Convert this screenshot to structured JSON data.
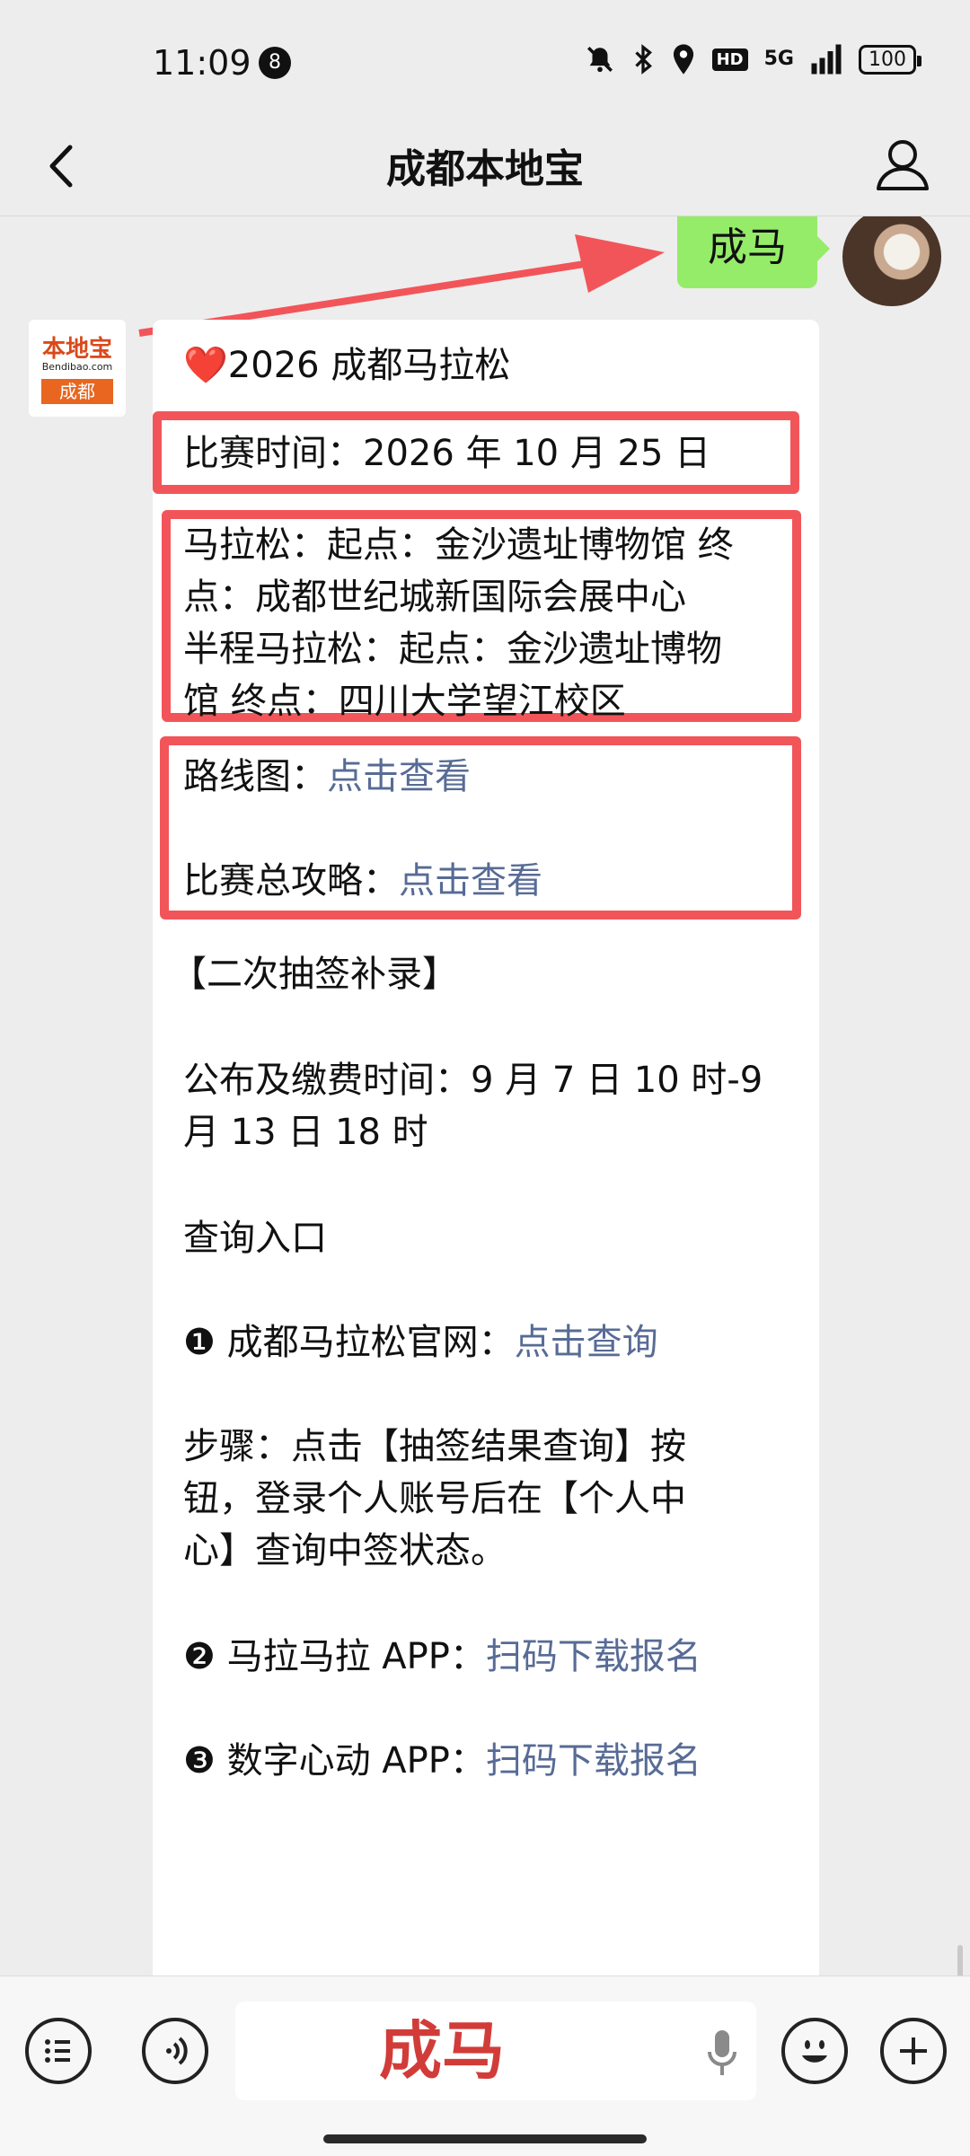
{
  "status_bar": {
    "time": "11:09",
    "notification_count": "8",
    "network": "5G",
    "hd": "HD",
    "battery": "100"
  },
  "nav": {
    "title": "成都本地宝"
  },
  "messages": {
    "sent_text": "成马",
    "bot_avatar": {
      "top": "本地宝",
      "mid": "Bendibao.com",
      "bottom": "成都"
    }
  },
  "card": {
    "heading": "❤️2026 成都马拉松",
    "race_time": "比赛时间：2026 年 10 月 25 日",
    "marathon_line1": "马拉松：起点：金沙遗址博物馆 终",
    "marathon_line2": "点：成都世纪城新国际会展中心",
    "half_line1": "半程马拉松：起点：金沙遗址博物",
    "half_line2": "馆 终点：四川大学望江校区",
    "route_label": "路线图：",
    "route_link": "点击查看",
    "guide_label": "比赛总攻略：",
    "guide_link": "点击查看",
    "second_draw": "【二次抽签补录】",
    "publish_line1": "公布及缴费时间：9 月 7 日 10 时-9",
    "publish_line2": "月 13 日 18 时",
    "query_entry": "查询入口",
    "official_label": "❶ 成都马拉松官网：",
    "official_link": "点击查询",
    "steps_line1": "步骤：点击【抽签结果查询】按",
    "steps_line2": "钮，登录个人账号后在【个人中",
    "steps_line3": "心】查询中签状态。",
    "app1_label": "❷ 马拉马拉 APP：",
    "app1_link": "扫码下载报名",
    "app2_label": "❸ 数字心动 APP：",
    "app2_link": "扫码下载报名"
  },
  "input_bar": {
    "text": "成马"
  },
  "colors": {
    "accent_green": "#95ec69",
    "link": "#576b95",
    "highlight_red": "#f25559"
  }
}
